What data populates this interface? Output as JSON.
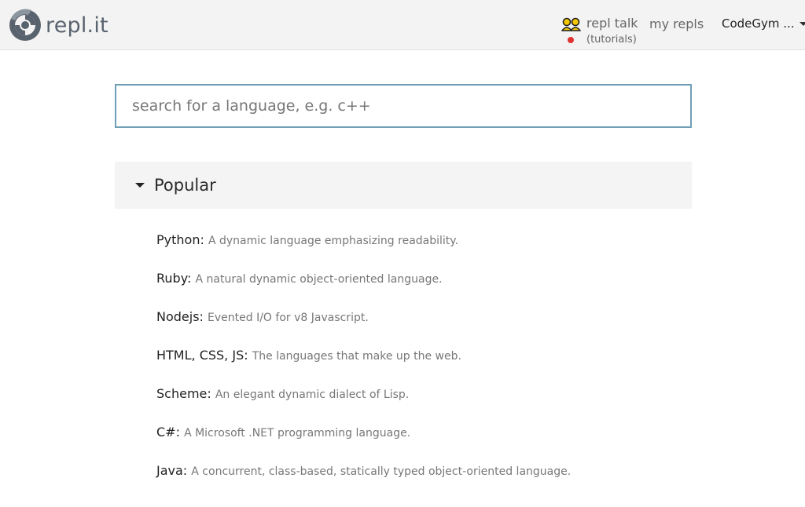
{
  "header": {
    "logo_text": "repl.it",
    "talk_label": "repl talk",
    "talk_sub": "(tutorials)",
    "my_repls": "my repls",
    "user_menu": "CodeGym ...",
    "colors": {
      "bar_bg": "#f3f3f3",
      "logo": "#59636e",
      "talk_icon": "#f2c800",
      "notification_dot": "#e0322f"
    },
    "icons": {
      "logo": "replit-swirl-logo",
      "talk": "people-icon",
      "user_menu": "caret-down-icon"
    }
  },
  "search": {
    "placeholder": "search for a language, e.g. c++",
    "value": "",
    "border_color": "#6f9fb6"
  },
  "popular": {
    "title": "Popular",
    "icon": "caret-down-icon",
    "items": [
      {
        "name": "Python:",
        "description": "A dynamic language emphasizing readability."
      },
      {
        "name": "Ruby:",
        "description": "A natural dynamic object-oriented language."
      },
      {
        "name": "Nodejs:",
        "description": "Evented I/O for v8 Javascript."
      },
      {
        "name": "HTML, CSS, JS:",
        "description": "The languages that make up the web."
      },
      {
        "name": "Scheme:",
        "description": "An elegant dynamic dialect of Lisp."
      },
      {
        "name": "C#:",
        "description": "A Microsoft .NET programming language."
      },
      {
        "name": "Java:",
        "description": "A concurrent, class-based, statically typed object-oriented language."
      }
    ]
  }
}
